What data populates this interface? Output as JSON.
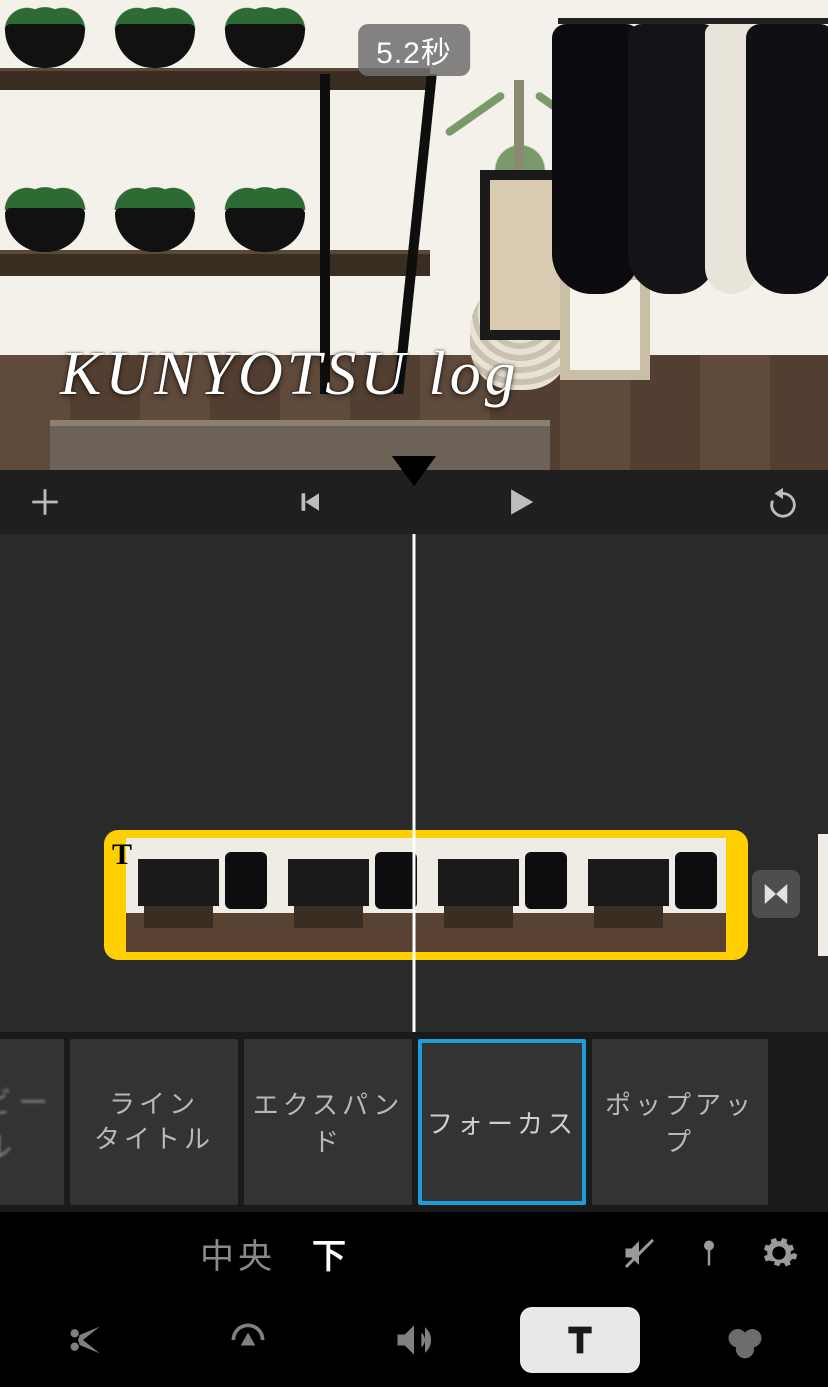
{
  "preview": {
    "duration_badge": "5.2秒",
    "title_text": "KUNYOTSU log"
  },
  "transport": {
    "add_icon": "plus-icon",
    "skip_back_icon": "skip-back-icon",
    "play_icon": "play-icon",
    "undo_icon": "undo-icon"
  },
  "timeline": {
    "clip_has_title_indicator": "T",
    "transition_icon": "transition-icon"
  },
  "title_styles": {
    "selected_index": 3,
    "items": [
      {
        "label": "リビール"
      },
      {
        "label": "ライン\nタイトル"
      },
      {
        "label": "エクスパンド"
      },
      {
        "label": "フォーカス"
      },
      {
        "label": "ポップアップ"
      }
    ]
  },
  "title_position": {
    "options": [
      {
        "key": "center",
        "label": "中央",
        "active": false
      },
      {
        "key": "bottom",
        "label": "下",
        "active": true
      }
    ]
  },
  "secondary_controls": {
    "mute_icon": "mute-icon",
    "pin_icon": "pin-icon",
    "settings_icon": "gear-icon"
  },
  "tool_tabs": {
    "active": "title",
    "items": [
      {
        "key": "cut",
        "icon": "scissors-icon"
      },
      {
        "key": "speed",
        "icon": "gauge-icon"
      },
      {
        "key": "audio",
        "icon": "volume-icon"
      },
      {
        "key": "title",
        "icon": "title-icon"
      },
      {
        "key": "filter",
        "icon": "filters-icon"
      }
    ]
  },
  "colors": {
    "clip_selection": "#ffcf00",
    "style_selection": "#1f9dd8"
  }
}
